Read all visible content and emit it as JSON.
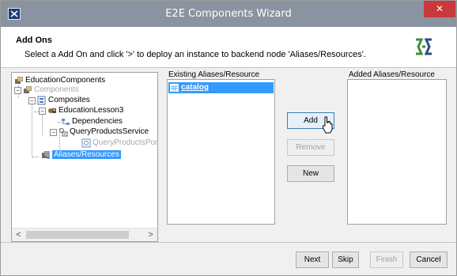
{
  "window": {
    "title": "E2E Components Wizard",
    "close_glyph": "✕"
  },
  "header": {
    "title": "Add Ons",
    "description": "Select a Add On and click '>' to deploy an instance to backend node 'Aliases/Resources'.",
    "logo_icon": "e2e-brand-logo"
  },
  "tree": {
    "nodes": [
      {
        "label": "EducationComponents",
        "icon": "package-icon",
        "state": "normal"
      },
      {
        "label": "Components",
        "icon": "package-icon",
        "state": "disabled"
      },
      {
        "label": "Composites",
        "icon": "composite-icon",
        "state": "normal"
      },
      {
        "label": "EducationLesson3",
        "icon": "lesson-icon",
        "state": "normal"
      },
      {
        "label": "Dependencies",
        "icon": "dependency-icon",
        "state": "normal"
      },
      {
        "label": "QueryProductsService",
        "icon": "service-icon",
        "state": "normal"
      },
      {
        "label": "QueryProductsPortT",
        "icon": "port-icon",
        "state": "disabled"
      },
      {
        "label": "Aliases/Resources",
        "icon": "resources-icon",
        "state": "selected"
      }
    ],
    "expander_minus": "−",
    "scroll_left": "<",
    "scroll_right": ">"
  },
  "existing": {
    "label": "Existing Aliases/Resource",
    "items": [
      {
        "label": "catalog",
        "icon": "table-icon",
        "selected": true
      }
    ]
  },
  "added": {
    "label": "Added Aliases/Resource",
    "items": []
  },
  "actions": {
    "add": "Add",
    "remove": "Remove",
    "new": "New"
  },
  "footer": {
    "next": "Next",
    "skip": "Skip",
    "finish": "Finish",
    "cancel": "Cancel"
  },
  "colors": {
    "titlebar": "#8a93a0",
    "close": "#c9383a",
    "selection": "#3399ff"
  }
}
